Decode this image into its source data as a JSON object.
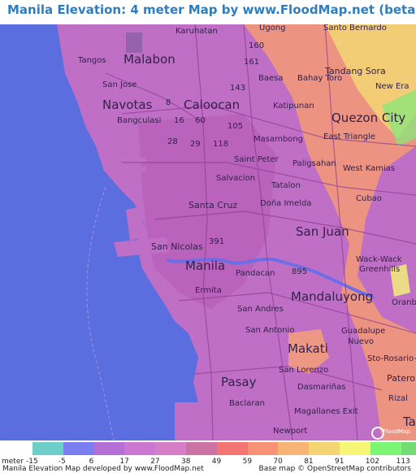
{
  "title": "Manila Elevation: 4 meter Map by www.FloodMap.net (beta)",
  "places": {
    "karuhatan": "Karuhatan",
    "ugong": "Ugong",
    "sanbernardo": "Santo Bernardo",
    "n160": "160",
    "n161": "161",
    "tangos": "Tangos",
    "malabon": "Malabon",
    "tandangsora": "Tandang Sora",
    "baesa": "Baesa",
    "bahaytoro": "Bahay Toro",
    "newera": "New Era",
    "sanjose": "San Jose",
    "n143": "143",
    "navotas": "Navotas",
    "n8": "8",
    "caloocan": "Caloocan",
    "katipunan": "Katipunan",
    "quezoncity": "Quezon City",
    "bangculasi": "Bangculasi",
    "n16": "16",
    "n60": "60",
    "n105": "105",
    "masambong": "Masambong",
    "easttriangle": "East Triangle",
    "n28": "28",
    "n29": "29",
    "n118": "118",
    "saintpeter": "Saint Peter",
    "paligsahan": "Paligsahan",
    "westkamias": "West Kamias",
    "salvacion": "Salvacion",
    "tatalon": "Tatalon",
    "cubao": "Cubao",
    "santacruz": "Santa Cruz",
    "donaimelda": "Doña Imelda",
    "sanjuan": "San Juan",
    "n391": "391",
    "sannicolas": "San Nicolas",
    "wackwack": "Wack-Wack",
    "greenhills": "Greenhills",
    "manila": "Manila",
    "pandacan": "Pandacan",
    "n895": "895",
    "ermita": "Ermita",
    "mandaluyong": "Mandaluyong",
    "oranbo": "Oranbo",
    "sanandres": "San Andres",
    "sanantonio": "San Antonio",
    "guadalupe": "Guadalupe",
    "nuevo": "Nuevo",
    "makati": "Makati",
    "storosario": "Sto-Rosario-",
    "sanlorenzo": "San Lorenzo",
    "pasay": "Pasay",
    "pateros": "Patero",
    "dasmarinas": "Dasmariñas",
    "rizal": "Rizal",
    "baclaran": "Baclaran",
    "magallanes": "Magallanes Exit",
    "newport": "Newport",
    "ta": "Ta"
  },
  "legend": {
    "unit_label": "meter",
    "ticks": [
      "-15",
      "-5",
      "6",
      "17",
      "27",
      "38",
      "49",
      "59",
      "70",
      "81",
      "91",
      "102",
      "113"
    ],
    "colors": [
      "#6ecfc9",
      "#7a7ef0",
      "#b470d6",
      "#cc78d2",
      "#d77ec8",
      "#cd72a4",
      "#f57474",
      "#f79274",
      "#f7b474",
      "#f5d474",
      "#f6f676",
      "#7cf474",
      "#74dc74"
    ]
  },
  "footer": {
    "left": "Manila Elevation Map developed by www.FloodMap.net",
    "right": "Base map © OpenStreetMap contributors"
  },
  "watermark": "FloodMap",
  "colors": {
    "sea": "#5a6ee0",
    "land": "#c573c8",
    "title": "#2f7dbe"
  }
}
